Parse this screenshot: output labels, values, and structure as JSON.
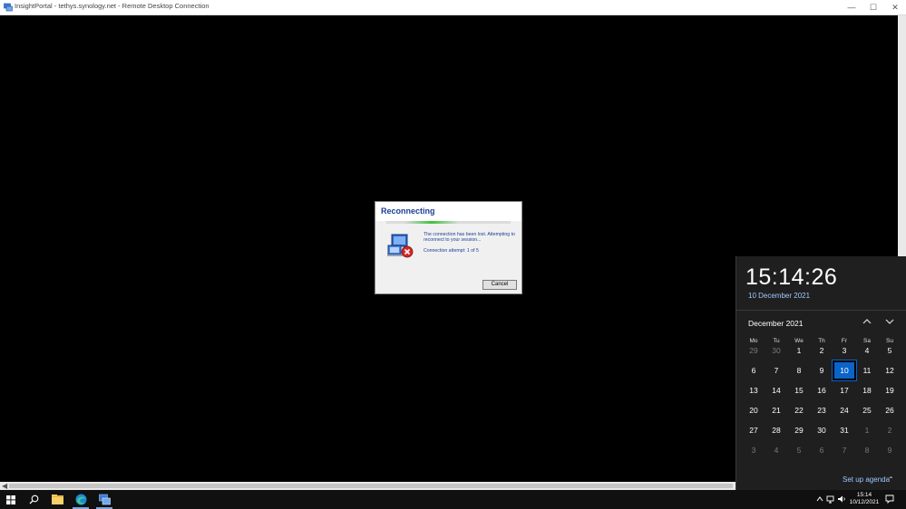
{
  "window": {
    "title": "InsightPortal - tethys.synology.net - Remote Desktop Connection",
    "controls": [
      "minimize",
      "maximize",
      "close"
    ]
  },
  "dialog": {
    "heading": "Reconnecting",
    "message": "The connection has been lost. Attempting to reconnect to your session...",
    "attempt": "Connection attempt: 1 of 5",
    "cancel_label": "Cancel"
  },
  "calendar": {
    "time": "15:14:26",
    "long_date": "10 December 2021",
    "month_label": "December 2021",
    "weekdays": [
      "Mo",
      "Tu",
      "We",
      "Th",
      "Fr",
      "Sa",
      "Su"
    ],
    "weeks": [
      [
        "29",
        "30",
        "1",
        "2",
        "3",
        "4",
        "5"
      ],
      [
        "6",
        "7",
        "8",
        "9",
        "10",
        "11",
        "12"
      ],
      [
        "13",
        "14",
        "15",
        "16",
        "17",
        "18",
        "19"
      ],
      [
        "20",
        "21",
        "22",
        "23",
        "24",
        "25",
        "26"
      ],
      [
        "27",
        "28",
        "29",
        "30",
        "31",
        "1",
        "2"
      ],
      [
        "3",
        "4",
        "5",
        "6",
        "7",
        "8",
        "9"
      ]
    ],
    "selected_day": "10",
    "agenda_label": "Set up agenda",
    "accent_color": "#0a64c9"
  },
  "taskbar": {
    "time": "15:14",
    "date": "10/12/2021",
    "pinned": [
      "start-icon",
      "search-icon",
      "file-explorer-icon",
      "edge-icon",
      "remote-desktop-icon"
    ]
  }
}
